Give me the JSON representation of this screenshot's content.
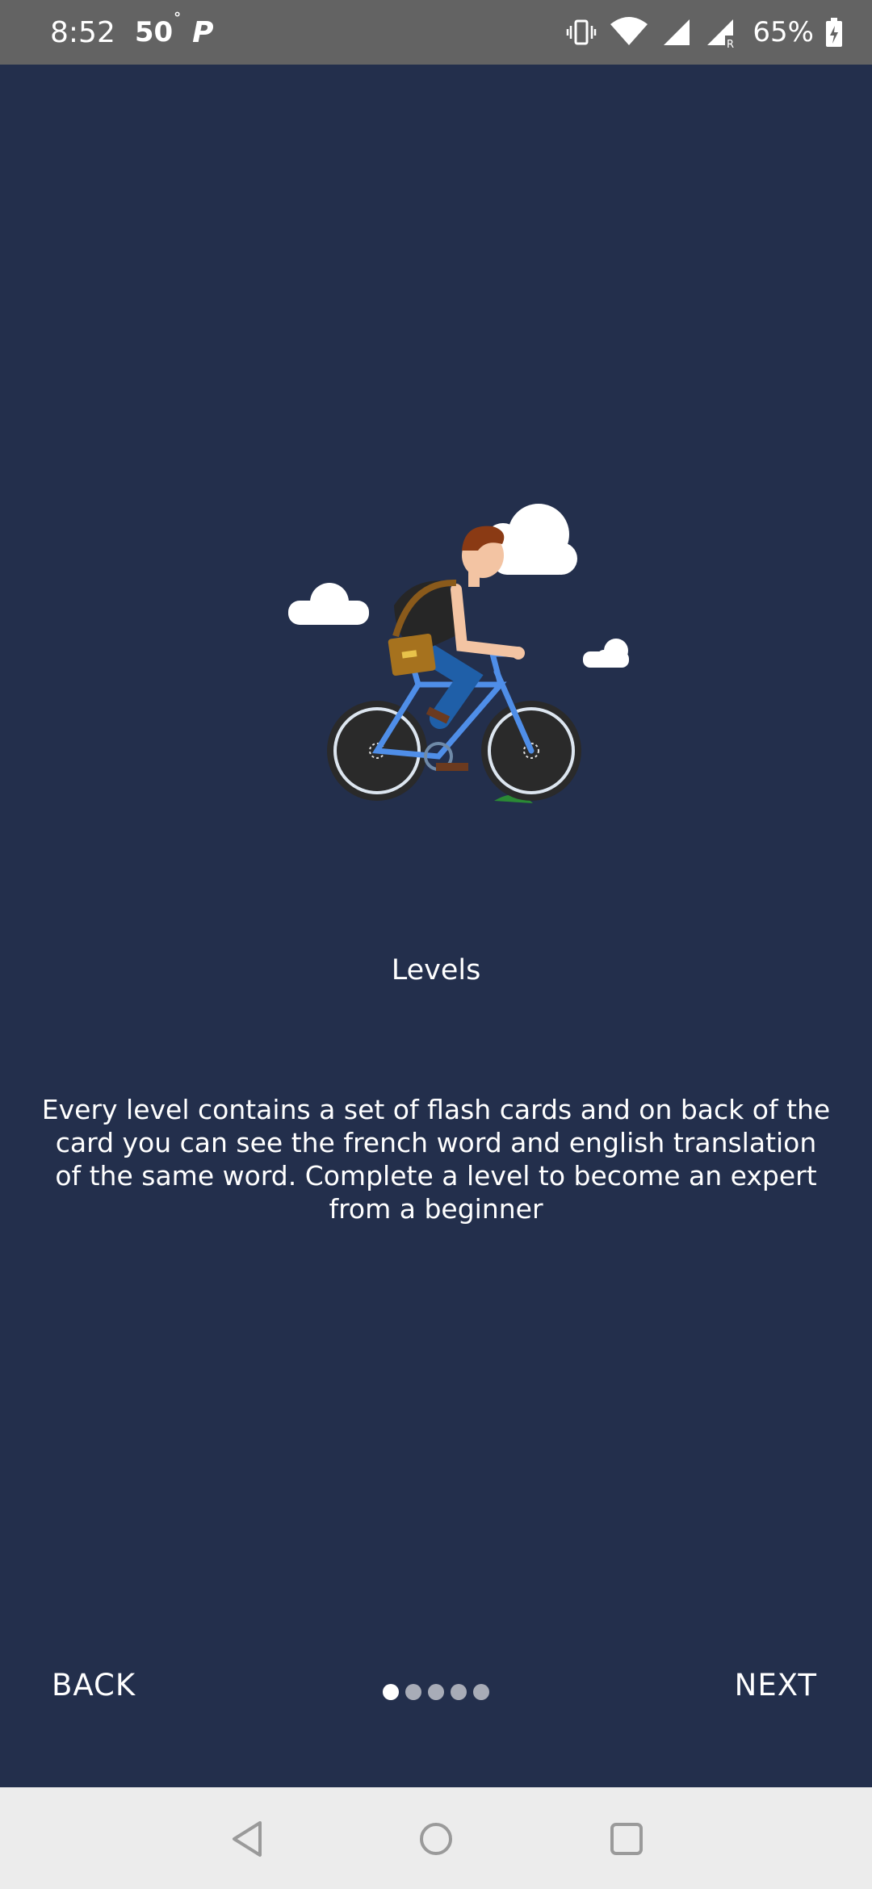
{
  "status_bar": {
    "time": "8:52",
    "temperature": "50",
    "temperature_unit": "°",
    "parking_label": "P",
    "battery_percent": "65%",
    "icons": [
      "vibrate-icon",
      "wifi-icon",
      "signal-icon",
      "signal-roaming-icon",
      "battery-charging-icon"
    ]
  },
  "slide": {
    "title": "Levels",
    "description": "Every level contains a set of flash cards and on back of the card you can see the french word and english translation of the same word. Complete a level to become an expert from a beginner"
  },
  "navigation": {
    "back_label": "BACK",
    "next_label": "NEXT",
    "page_count": 5,
    "current_page": 1
  },
  "system_nav": {
    "icons": [
      "back-triangle-icon",
      "home-circle-icon",
      "recents-square-icon"
    ]
  },
  "colors": {
    "background": "#232f4c",
    "status_bar": "#636363",
    "nav_bar": "#ececec",
    "text": "#ffffff",
    "dot_inactive": "#a8acb7"
  }
}
